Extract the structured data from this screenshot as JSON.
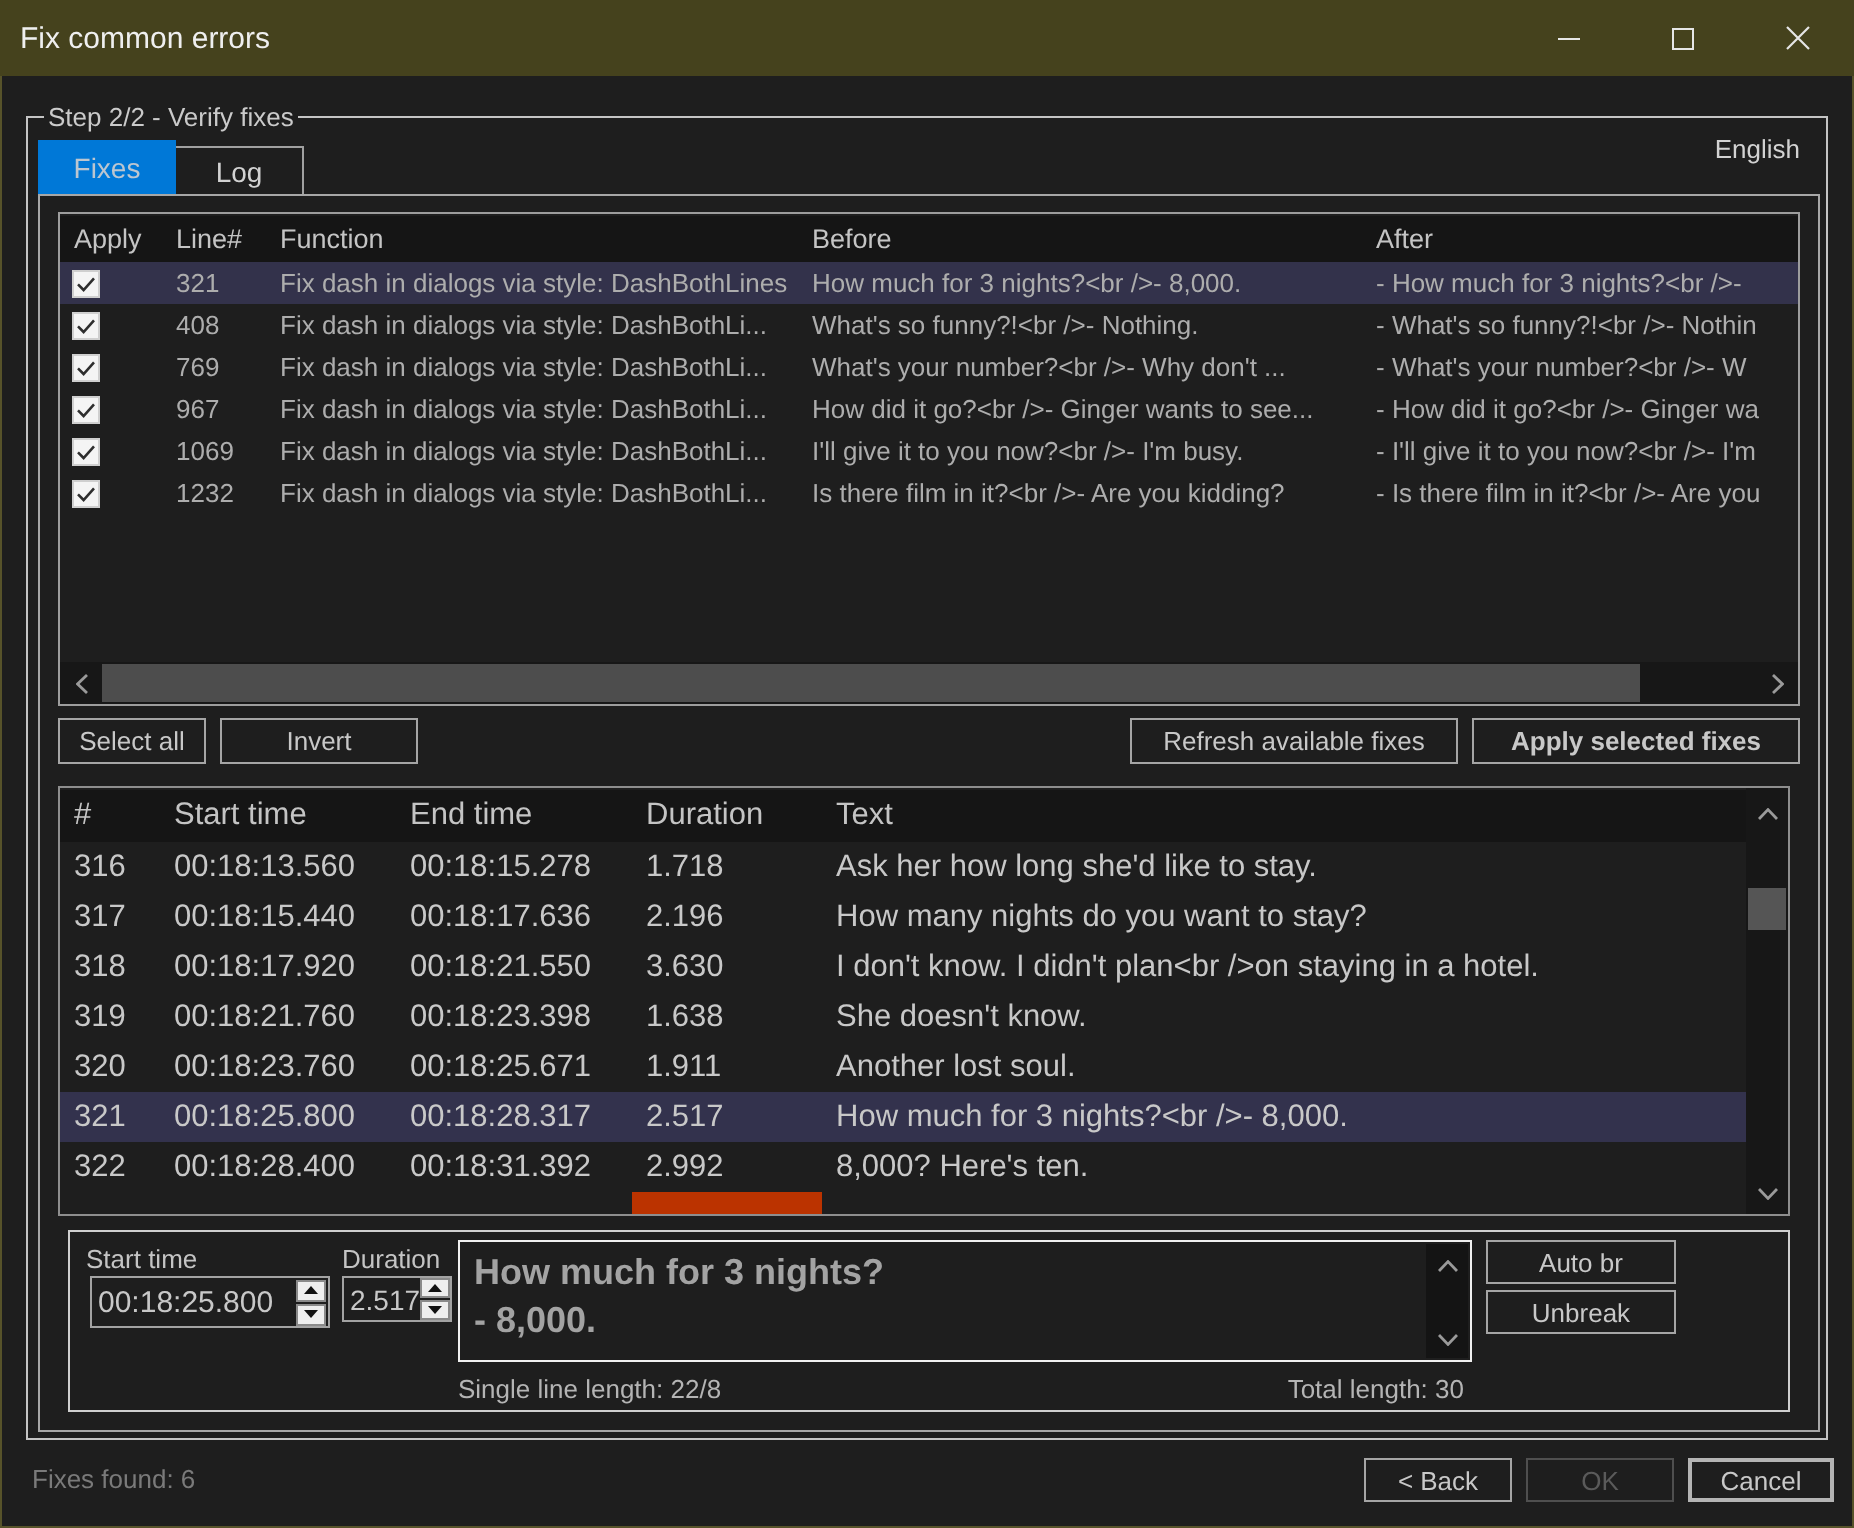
{
  "window": {
    "title": "Fix common errors"
  },
  "step": {
    "title": "Step 2/2 - Verify fixes",
    "language": "English",
    "tabs": [
      {
        "label": "Fixes",
        "selected": true
      },
      {
        "label": "Log",
        "selected": false
      }
    ]
  },
  "fixes_table": {
    "columns": [
      "Apply",
      "Line#",
      "Function",
      "Before",
      "After"
    ],
    "rows": [
      {
        "apply": true,
        "selected": true,
        "line": "321",
        "function": "Fix dash in dialogs via style: DashBothLines",
        "before": "How much for 3 nights?<br />- 8,000.",
        "after": "- How much for 3 nights?<br />-"
      },
      {
        "apply": true,
        "selected": false,
        "line": "408",
        "function": "Fix dash in dialogs via style: DashBothLi...",
        "before": "What's so funny?!<br />- Nothing.",
        "after": "- What's so funny?!<br />- Nothin"
      },
      {
        "apply": true,
        "selected": false,
        "line": "769",
        "function": "Fix dash in dialogs via style: DashBothLi...",
        "before": "What's your number?<br />- Why don't ...",
        "after": "- What's your number?<br />- W"
      },
      {
        "apply": true,
        "selected": false,
        "line": "967",
        "function": "Fix dash in dialogs via style: DashBothLi...",
        "before": "How did it go?<br />- Ginger wants to see...",
        "after": "- How did it go?<br />- Ginger wa"
      },
      {
        "apply": true,
        "selected": false,
        "line": "1069",
        "function": "Fix dash in dialogs via style: DashBothLi...",
        "before": "I'll give it to you now?<br />- I'm busy.",
        "after": "- I'll give it to you now?<br />- I'm"
      },
      {
        "apply": true,
        "selected": false,
        "line": "1232",
        "function": "Fix dash in dialogs via style: DashBothLi...",
        "before": "Is there film in it?<br />- Are you kidding?",
        "after": "- Is there film in it?<br />- Are you"
      }
    ]
  },
  "selection_buttons": [
    {
      "label": "Select all",
      "bold": false
    },
    {
      "label": "Invert",
      "bold": false
    }
  ],
  "fix_buttons": [
    {
      "label": "Refresh available fixes",
      "bold": false
    },
    {
      "label": "Apply selected fixes",
      "bold": true
    }
  ],
  "subtitle_list": {
    "columns": [
      "#",
      "Start time",
      "End time",
      "Duration",
      "Text"
    ],
    "rows": [
      {
        "number": "316",
        "start": "00:18:13.560",
        "end": "00:18:15.278",
        "duration": "1.718",
        "text": "Ask her how long she'd like to stay.",
        "selected": false,
        "duration_warning": false
      },
      {
        "number": "317",
        "start": "00:18:15.440",
        "end": "00:18:17.636",
        "duration": "2.196",
        "text": "How many nights do you want to stay?",
        "selected": false,
        "duration_warning": false
      },
      {
        "number": "318",
        "start": "00:18:17.920",
        "end": "00:18:21.550",
        "duration": "3.630",
        "text": "I don't know. I didn't plan<br />on staying in a hotel.",
        "selected": false,
        "duration_warning": false
      },
      {
        "number": "319",
        "start": "00:18:21.760",
        "end": "00:18:23.398",
        "duration": "1.638",
        "text": "She doesn't know.",
        "selected": false,
        "duration_warning": false
      },
      {
        "number": "320",
        "start": "00:18:23.760",
        "end": "00:18:25.671",
        "duration": "1.911",
        "text": "Another lost soul.",
        "selected": false,
        "duration_warning": false
      },
      {
        "number": "321",
        "start": "00:18:25.800",
        "end": "00:18:28.317",
        "duration": "2.517",
        "text": "How much for 3 nights?<br />- 8,000.",
        "selected": true,
        "duration_warning": false
      },
      {
        "number": "322",
        "start": "00:18:28.400",
        "end": "00:18:31.392",
        "duration": "2.992",
        "text": "8,000? Here's ten.",
        "selected": false,
        "duration_warning": false
      },
      {
        "selected": false,
        "duration_warning": true
      }
    ]
  },
  "editor": {
    "start_time": {
      "label": "Start time",
      "value": "00:18:25.800"
    },
    "duration": {
      "label": "Duration",
      "value": "2.517"
    },
    "text": "How much for 3 nights?\n- 8,000.",
    "single_line_length": "Single line length: 22/8",
    "total_length": "Total length: 30",
    "buttons": [
      {
        "label": "Auto br"
      },
      {
        "label": "Unbreak"
      }
    ]
  },
  "status_bar": {
    "text": "Fixes found: 6"
  },
  "dialog_buttons": [
    {
      "label": "< Back",
      "disabled": false,
      "default": false
    },
    {
      "label": "OK",
      "disabled": true,
      "default": false
    },
    {
      "label": "Cancel",
      "disabled": false,
      "default": true
    }
  ]
}
